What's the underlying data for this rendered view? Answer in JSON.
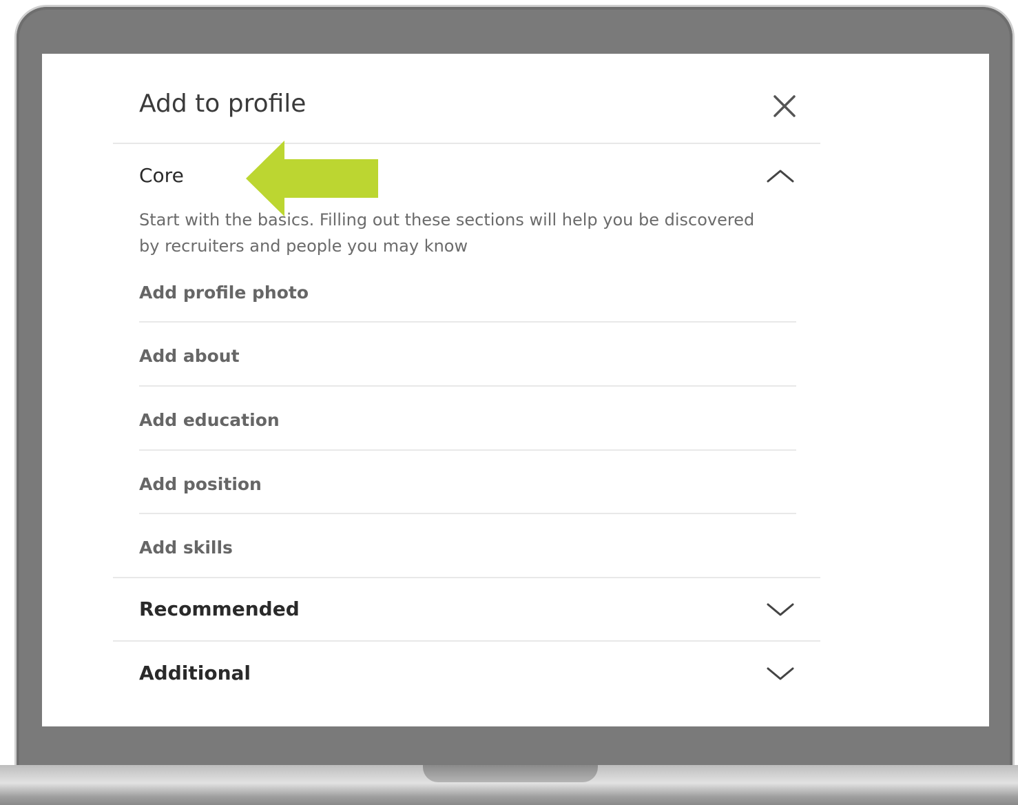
{
  "modal": {
    "title": "Add to profile",
    "close_label": "Close"
  },
  "sections": {
    "core": {
      "title": "Core",
      "expanded": true,
      "description": "Start with the basics. Filling out these sections will help you be discovered by recruiters and people you may know",
      "items": [
        {
          "label": "Add profile photo"
        },
        {
          "label": "Add about"
        },
        {
          "label": "Add education"
        },
        {
          "label": "Add position"
        },
        {
          "label": "Add skills"
        }
      ]
    },
    "recommended": {
      "title": "Recommended",
      "expanded": false
    },
    "additional": {
      "title": "Additional",
      "expanded": false
    }
  },
  "colors": {
    "annotation_arrow": "#bcd631",
    "laptop_frame": "#7a7a7a",
    "title_text": "#3a3a3a",
    "muted_text": "#6b6b6b"
  },
  "icons": {
    "close": "close-icon",
    "expanded": "chevron-up-icon",
    "collapsed": "chevron-down-icon"
  }
}
